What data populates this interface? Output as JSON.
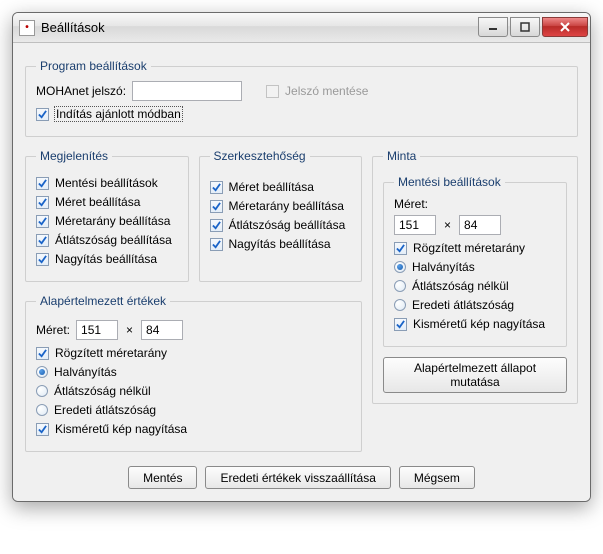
{
  "window": {
    "title": "Beállítások"
  },
  "program": {
    "legend": "Program beállítások",
    "password_label": "MOHAnet jelszó:",
    "password_value": "",
    "save_password_label": "Jelszó mentése",
    "recommended_mode_label": "Indítás ajánlott módban"
  },
  "display": {
    "legend": "Megjelenítés",
    "opts": [
      "Mentési beállítások",
      "Méret beállítása",
      "Méretarány beállítása",
      "Átlátszóság beállítása",
      "Nagyítás beállítása"
    ]
  },
  "edit": {
    "legend": "Szerkesztehőség",
    "opts": [
      "Méret beállítása",
      "Méretarány beállítása",
      "Átlátszóság beállítása",
      "Nagyítás beállítása"
    ]
  },
  "defaults": {
    "legend": "Alapértelmezett értékek",
    "size_label": "Méret:",
    "width": "151",
    "height": "84",
    "times": "×",
    "fixed_ratio": "Rögzített méretarány",
    "radios": [
      "Halványítás",
      "Átlátszóság nélkül",
      "Eredeti átlátszóság"
    ],
    "small_zoom": "Kisméretű kép nagyítása"
  },
  "sample": {
    "legend": "Minta",
    "save_legend": "Mentési beállítások",
    "size_label": "Méret:",
    "width": "151",
    "height": "84",
    "times": "×",
    "fixed_ratio": "Rögzített méretarány",
    "radios": [
      "Halványítás",
      "Átlátszóság nélkül",
      "Eredeti átlátszóság"
    ],
    "small_zoom": "Kisméretű kép nagyítása",
    "show_default_btn": "Alapértelmezett állapot mutatása"
  },
  "buttons": {
    "save": "Mentés",
    "reset": "Eredeti értékek visszaállítása",
    "cancel": "Mégsem"
  }
}
